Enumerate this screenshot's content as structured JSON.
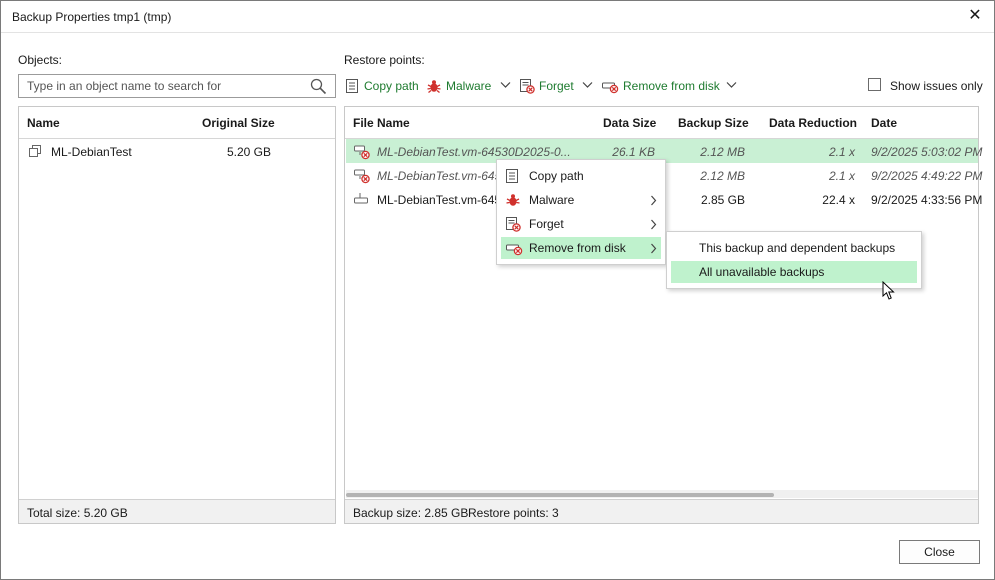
{
  "window": {
    "title": "Backup Properties tmp1 (tmp)",
    "close_icon": "close-icon"
  },
  "objects": {
    "label": "Objects:",
    "search_placeholder": "Type in an object name to search for",
    "columns": {
      "name": "Name",
      "original_size": "Original Size"
    },
    "rows": [
      {
        "name": "ML-DebianTest",
        "size": "5.20 GB"
      }
    ],
    "footer": "Total size: 5.20 GB"
  },
  "restore": {
    "label": "Restore points:",
    "toolbar": {
      "copy_path": "Copy path",
      "malware": "Malware",
      "forget": "Forget",
      "remove_from_disk": "Remove from disk"
    },
    "show_issues_only": "Show issues only",
    "columns": {
      "file_name": "File Name",
      "data_size": "Data Size",
      "backup_size": "Backup Size",
      "data_reduction": "Data Reduction",
      "date": "Date"
    },
    "rows": [
      {
        "file": "ML-DebianTest.vm-64530D2025-0...",
        "data_size": "26.1 KB",
        "backup_size": "2.12 MB",
        "reduction": "2.1 x",
        "date": "9/2/2025 5:03:02 PM"
      },
      {
        "file": "ML-DebianTest.vm-645",
        "data_size": "",
        "backup_size": "2.12 MB",
        "reduction": "2.1 x",
        "date": "9/2/2025 4:49:22 PM"
      },
      {
        "file": "ML-DebianTest.vm-645",
        "data_size": "",
        "backup_size": "2.85 GB",
        "reduction": "22.4 x",
        "date": "9/2/2025 4:33:56 PM"
      }
    ],
    "footer": {
      "backup_size": "Backup size: 2.85 GB",
      "restore_points": "Restore points: 3"
    }
  },
  "context_menu": {
    "items": [
      {
        "label": "Copy path"
      },
      {
        "label": "Malware"
      },
      {
        "label": "Forget"
      },
      {
        "label": "Remove from disk"
      }
    ]
  },
  "submenu": {
    "items": [
      {
        "label": "This backup and dependent backups"
      },
      {
        "label": "All unavailable backups"
      }
    ]
  },
  "buttons": {
    "close": "Close"
  },
  "colors": {
    "accent_green": "#1e7b2f",
    "selection": "#c9f0d4",
    "menu_highlight": "#bff2cd",
    "error_red": "#d0312d"
  }
}
